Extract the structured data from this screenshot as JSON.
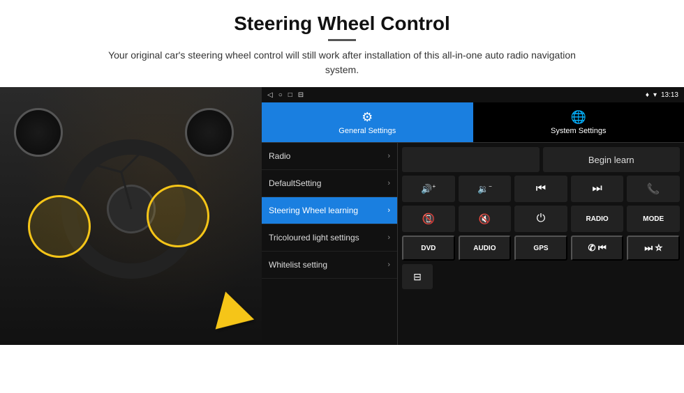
{
  "page": {
    "title": "Steering Wheel Control",
    "subtitle": "Your original car's steering wheel control will still work after installation of this all-in-one auto radio navigation system."
  },
  "status_bar": {
    "nav_icons": [
      "◁",
      "○",
      "□",
      "⊟"
    ],
    "right": "9 ▾ 13:13"
  },
  "tabs": [
    {
      "id": "general",
      "label": "General Settings",
      "icon": "⚙",
      "active": true
    },
    {
      "id": "system",
      "label": "System Settings",
      "icon": "🌐",
      "active": false
    }
  ],
  "menu": [
    {
      "id": "radio",
      "label": "Radio",
      "active": false
    },
    {
      "id": "default",
      "label": "DefaultSetting",
      "active": false
    },
    {
      "id": "steering",
      "label": "Steering Wheel learning",
      "active": true
    },
    {
      "id": "tricoloured",
      "label": "Tricoloured light settings",
      "active": false
    },
    {
      "id": "whitelist",
      "label": "Whitelist setting",
      "active": false
    }
  ],
  "controls": {
    "begin_learn_label": "Begin learn",
    "row1": [
      {
        "id": "vol-up",
        "icon": "🔊+",
        "text": "◀|+"
      },
      {
        "id": "vol-down",
        "icon": "🔉-",
        "text": "◀|−"
      },
      {
        "id": "prev-track",
        "icon": "|◀◀",
        "text": "⏮"
      },
      {
        "id": "next-track",
        "icon": "▶▶|",
        "text": "⏭"
      },
      {
        "id": "phone",
        "icon": "📞",
        "text": "✆"
      }
    ],
    "row2": [
      {
        "id": "hangup",
        "icon": "📵",
        "text": "✆"
      },
      {
        "id": "mute",
        "icon": "🔇",
        "text": "🔇×"
      },
      {
        "id": "power",
        "icon": "⏻",
        "text": "⏻"
      },
      {
        "id": "radio-btn",
        "text": "RADIO"
      },
      {
        "id": "mode-btn",
        "text": "MODE"
      }
    ],
    "row3": [
      {
        "id": "dvd",
        "text": "DVD"
      },
      {
        "id": "audio",
        "text": "AUDIO"
      },
      {
        "id": "gps",
        "text": "GPS"
      },
      {
        "id": "phone2",
        "icon": "✆⏮",
        "text": "✆⏮"
      },
      {
        "id": "skip",
        "text": "⏭☆"
      }
    ],
    "row4": [
      {
        "id": "media",
        "icon": "⊟",
        "text": "⊟"
      }
    ]
  }
}
